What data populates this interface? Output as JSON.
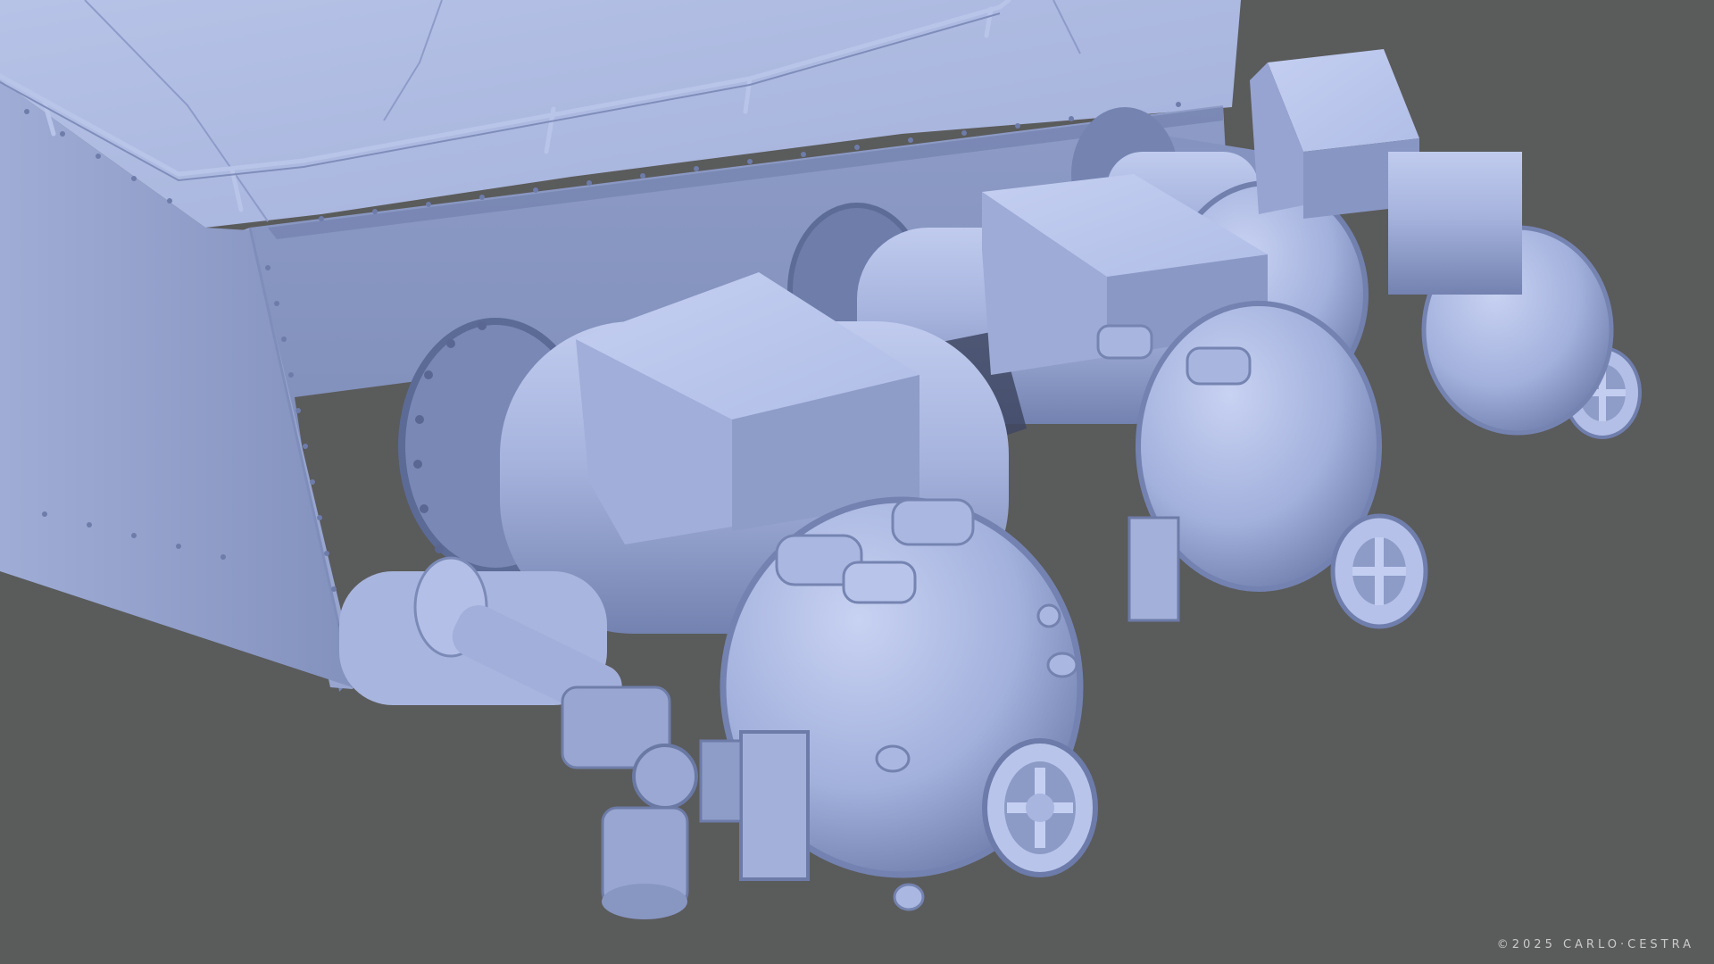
{
  "scene": {
    "subject": "hull-mounted-cylinder-units",
    "unit_count": 3,
    "colors": {
      "background": "#5a5b5b",
      "model_light": "#b2bfe4",
      "model_mid": "#8c9bc6",
      "model_dark": "#5e6a92",
      "shadow": "#3f4863",
      "credit_text": "#c9c9c9"
    }
  },
  "credit": {
    "text": "©2025 CARLO·CESTRA"
  }
}
